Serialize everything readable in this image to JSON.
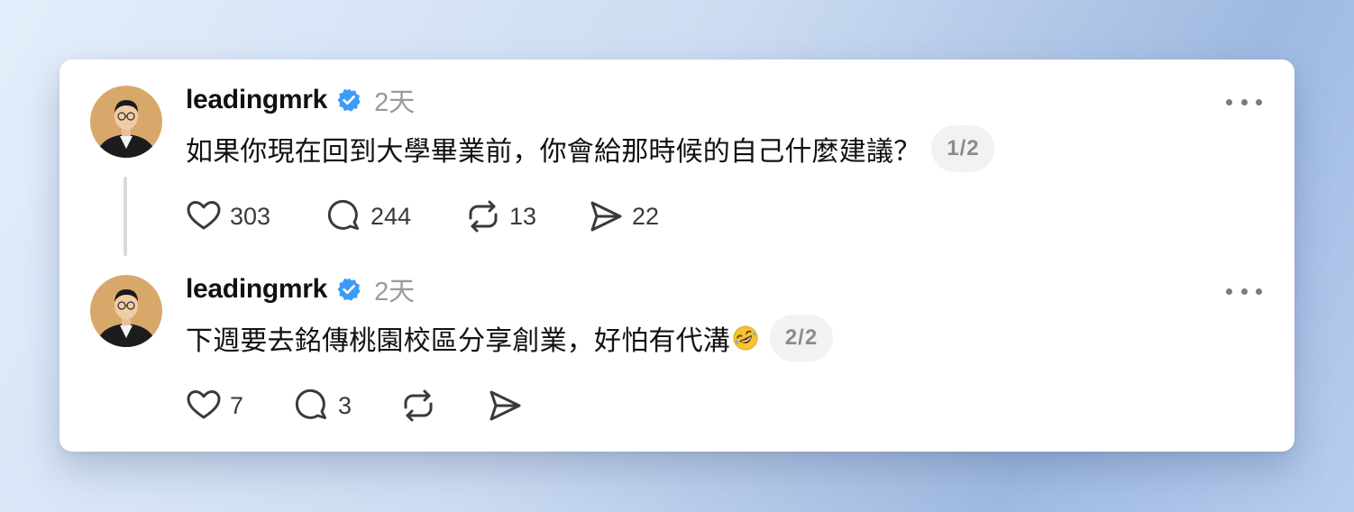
{
  "posts": [
    {
      "username": "leadingmrk",
      "time": "2天",
      "text": "如果你現在回到大學畢業前，你會給那時候的自己什麼建議？",
      "thread_counter": "1/2",
      "stats": {
        "likes": "303",
        "replies": "244",
        "reposts": "13",
        "shares": "22"
      }
    },
    {
      "username": "leadingmrk",
      "time": "2天",
      "text": "下週要去銘傳桃園校區分享創業，好怕有代溝",
      "emoji": "rolling-on-floor-laughing",
      "thread_counter": "2/2",
      "stats": {
        "likes": "7",
        "replies": "3",
        "reposts": "",
        "shares": ""
      }
    }
  ],
  "colors": {
    "verified": "#3d9bf5",
    "text": "#111111",
    "muted": "#9a9a9a",
    "thread_line": "#d9d9d9"
  }
}
